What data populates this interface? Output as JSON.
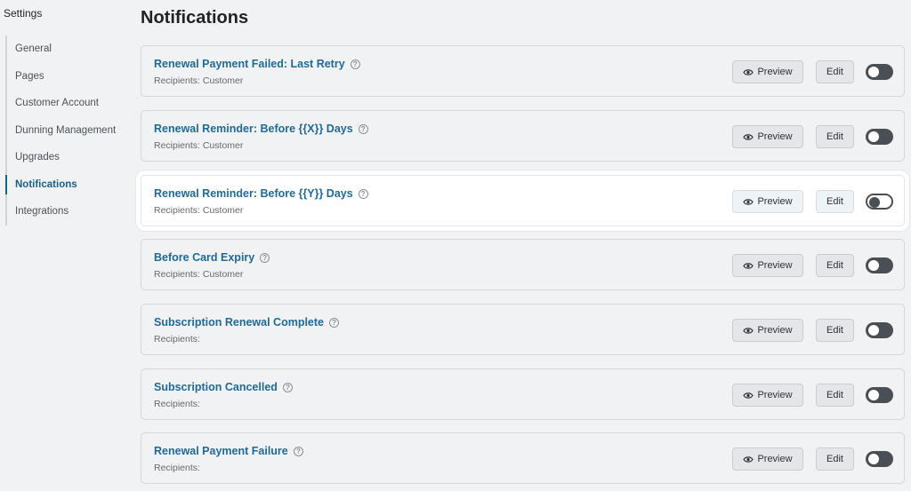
{
  "sidebar": {
    "title": "Settings",
    "items": [
      {
        "label": "General",
        "active": false
      },
      {
        "label": "Pages",
        "active": false
      },
      {
        "label": "Customer Account",
        "active": false
      },
      {
        "label": "Dunning Management",
        "active": false
      },
      {
        "label": "Upgrades",
        "active": false
      },
      {
        "label": "Notifications",
        "active": true
      },
      {
        "label": "Integrations",
        "active": false
      }
    ]
  },
  "main": {
    "title": "Notifications",
    "notifications": [
      {
        "title": "Renewal Payment Failed: Last Retry",
        "recipients_label": "Recipients:",
        "recipients": "Customer",
        "enabled": true
      },
      {
        "title": "Renewal Reminder: Before {{X}} Days",
        "recipients_label": "Recipients:",
        "recipients": "Customer",
        "enabled": true
      },
      {
        "title": "Renewal Reminder: Before {{Y}} Days",
        "recipients_label": "Recipients:",
        "recipients": "Customer",
        "enabled": false
      },
      {
        "title": "Before Card Expiry",
        "recipients_label": "Recipients:",
        "recipients": "Customer",
        "enabled": true
      },
      {
        "title": "Subscription Renewal Complete",
        "recipients_label": "Recipients:",
        "recipients": "",
        "enabled": true
      },
      {
        "title": "Subscription Cancelled",
        "recipients_label": "Recipients:",
        "recipients": "",
        "enabled": true
      },
      {
        "title": "Renewal Payment Failure",
        "recipients_label": "Recipients:",
        "recipients": "",
        "enabled": true
      }
    ],
    "preview_label": "Preview",
    "edit_label": "Edit",
    "help_glyph": "?"
  },
  "icons": {
    "help": "help-icon",
    "preview": "eye-icon",
    "toggle": "toggle-switch"
  },
  "colors": {
    "link": "#1f6a98",
    "background": "#f1f2f4",
    "toggle_on": "#4a4f55"
  }
}
